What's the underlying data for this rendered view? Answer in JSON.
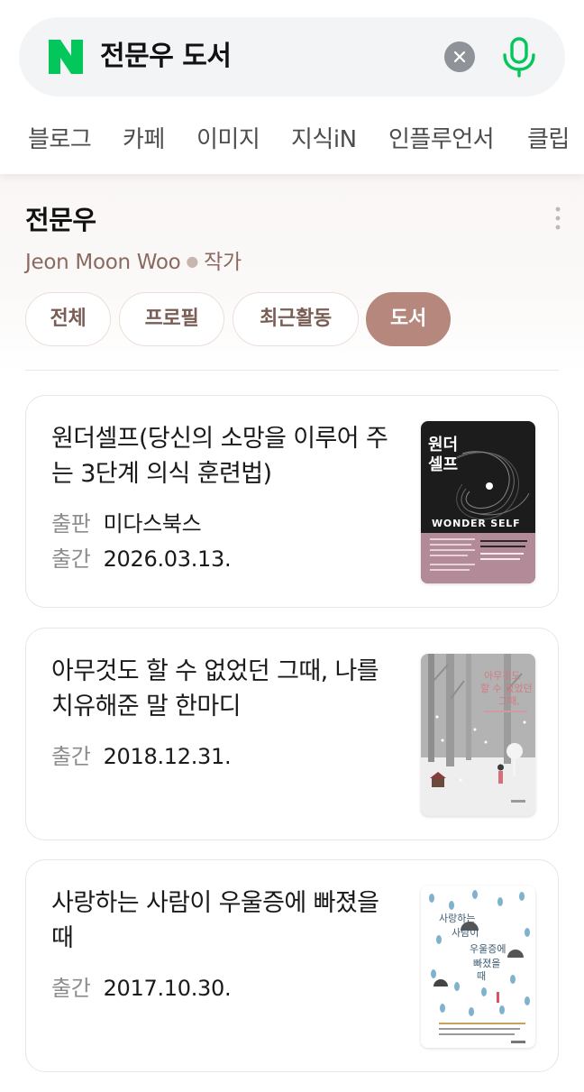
{
  "search": {
    "query": "전문우 도서"
  },
  "nav_tabs": [
    "블로그",
    "카페",
    "이미지",
    "지식iN",
    "인플루언서",
    "클립"
  ],
  "profile": {
    "name": "전문우",
    "romanized": "Jeon Moon Woo",
    "role": "작가",
    "chips": [
      "전체",
      "프로필",
      "최근활동",
      "도서"
    ],
    "active_chip": "도서"
  },
  "books": [
    {
      "title": "원더셀프(당신의 소망을 이루어 주는 3단계 의식 훈련법)",
      "publisher_label": "출판",
      "publisher": "미다스북스",
      "date_label": "출간",
      "date": "2026.03.13.",
      "cover_title_kr": "원더셀프",
      "cover_title_en": "WONDER SELF"
    },
    {
      "title": "아무것도 할 수 없었던 그때, 나를 치유해준 말 한마디",
      "date_label": "출간",
      "date": "2018.12.31."
    },
    {
      "title": "사랑하는 사람이 우울증에 빠졌을 때",
      "date_label": "출간",
      "date": "2017.10.30."
    }
  ],
  "colors": {
    "naver_green": "#03c75a",
    "chip_active": "#b6877c",
    "subline": "#8a6a60"
  }
}
